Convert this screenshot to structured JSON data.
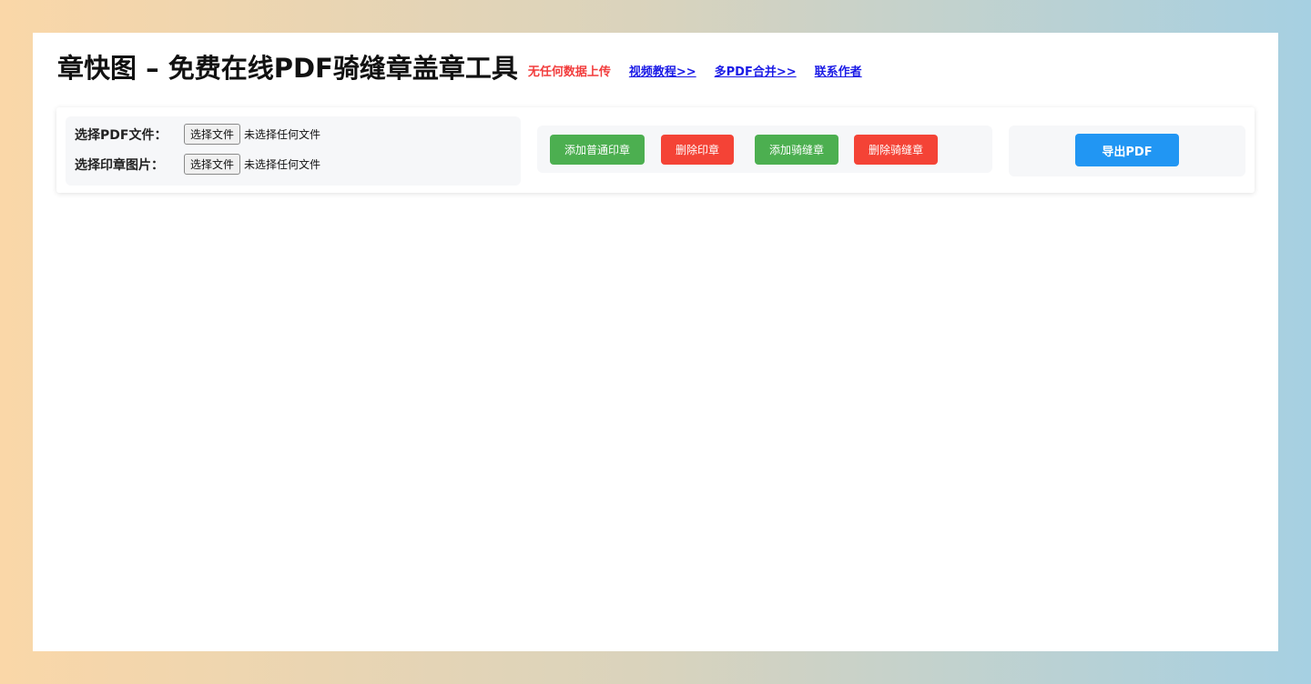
{
  "header": {
    "title": "章快图 – 免费在线PDF骑缝章盖章工具",
    "no_upload_note": "无任何数据上传",
    "links": {
      "video_tutorial": "视频教程>>",
      "merge_pdf": "多PDF合并>>",
      "contact_author": "联系作者"
    }
  },
  "file_inputs": {
    "pdf": {
      "label": "选择PDF文件：",
      "button": "选择文件",
      "status": "未选择任何文件"
    },
    "stamp": {
      "label": "选择印章图片：",
      "button": "选择文件",
      "status": "未选择任何文件"
    }
  },
  "actions": {
    "add_normal_stamp": "添加普通印章",
    "delete_stamp": "删除印章",
    "add_seam_stamp": "添加骑缝章",
    "delete_seam_stamp": "删除骑缝章"
  },
  "export": {
    "button": "导出PDF"
  },
  "colors": {
    "green": "#4caf50",
    "red": "#f44336",
    "blue": "#2196f3",
    "warning_text": "#f23c3c",
    "link": "#1a1ae6"
  }
}
